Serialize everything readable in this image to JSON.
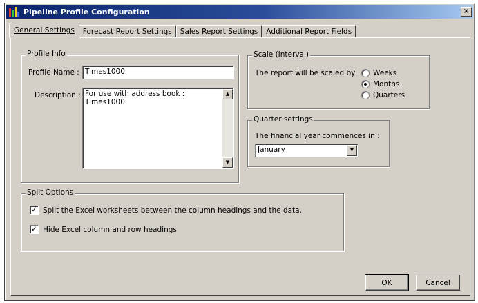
{
  "window": {
    "title": "Pipeline Profile Configuration",
    "close_glyph": "×",
    "icon": "chart-app-icon"
  },
  "tabs": [
    {
      "label": "General Settings",
      "active": true
    },
    {
      "label": "Forecast Report Settings",
      "active": false
    },
    {
      "label": "Sales Report Settings",
      "active": false
    },
    {
      "label": "Additional Report Fields",
      "active": false
    }
  ],
  "profile_info": {
    "title": "Profile Info",
    "name_label": "Profile Name :",
    "name_value": "Times1000",
    "description_label": "Description :",
    "description_value": "For use with address book : Times1000"
  },
  "scale": {
    "title": "Scale (Interval)",
    "prompt": "The report will be scaled by",
    "options": [
      {
        "label": "Weeks",
        "checked": false
      },
      {
        "label": "Months",
        "checked": true
      },
      {
        "label": "Quarters",
        "checked": false
      }
    ]
  },
  "quarter": {
    "title": "Quarter settings",
    "prompt": "The financial year commences in :",
    "selected": "January"
  },
  "split_options": {
    "title": "Split Options",
    "items": [
      {
        "label": "Split the Excel worksheets between the column headings and the data.",
        "checked": true
      },
      {
        "label": "Hide Excel column and row headings",
        "checked": true
      }
    ]
  },
  "buttons": {
    "ok": "OK",
    "cancel": "Cancel"
  },
  "glyphs": {
    "check": "✓",
    "up": "▲",
    "down": "▼"
  },
  "colors": {
    "face": "#d4d0c8",
    "titlebar_start": "#0a246a",
    "titlebar_end": "#a6caf0"
  }
}
